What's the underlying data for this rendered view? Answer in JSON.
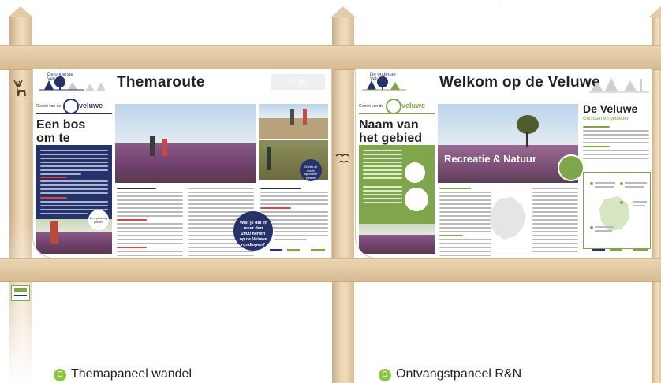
{
  "panel_c": {
    "title": "Themaroute",
    "logo_placeholder": "Logo",
    "logo_text": "De onderste Veluwe",
    "brand_prefix": "Geniet van de",
    "brand_name": "veluwe",
    "headline": "Een bos om te ontdekken",
    "bubble_small": "Een prachtig gebied",
    "bubble_photo": "Ontdek de mooie bijzondere plekken",
    "bubble_big": "Wist je dat er meer dan 2000 herten op de Veluwe rondlopen?",
    "caption_letter": "C",
    "caption": "Themapaneel wandel"
  },
  "panel_d": {
    "title": "Welkom op de Veluwe",
    "logo_text": "De onderste Veluwe",
    "brand_prefix": "Geniet van de",
    "brand_name": "veluwe",
    "headline": "Naam van het gebied",
    "photo_label": "Recreatie & Natuur",
    "right_title": "De Veluwe",
    "right_subtitle": "Ontstaan en gebieden",
    "caption_letter": "D",
    "caption": "Ontvangstpaneel R&N"
  },
  "colors": {
    "navy": "#26336a",
    "green": "#7fa64a",
    "badge": "#8cc63f",
    "wood": "#e3cca7"
  }
}
